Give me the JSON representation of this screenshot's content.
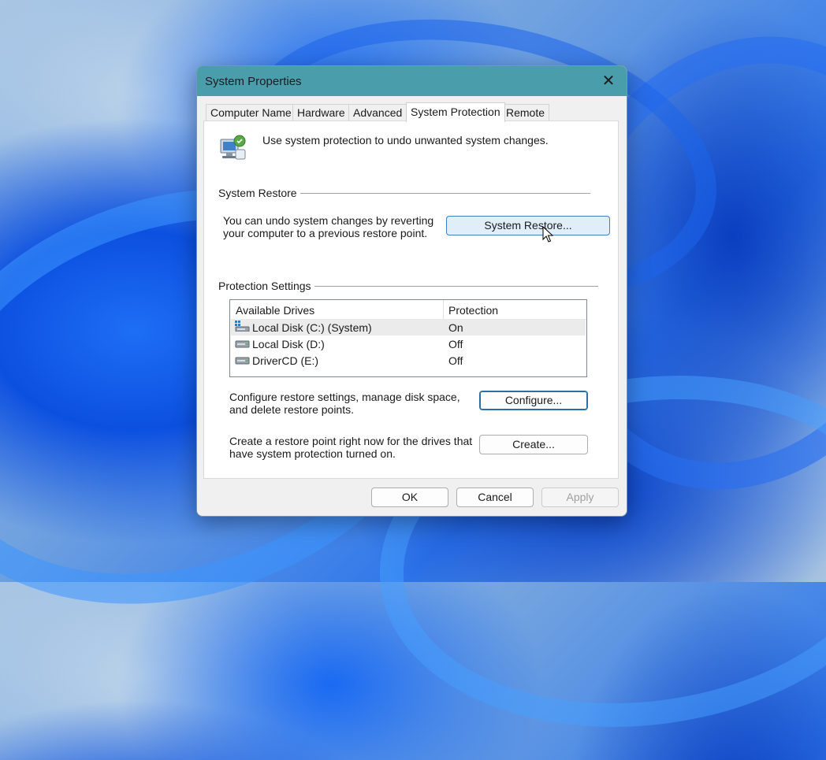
{
  "window": {
    "title": "System Properties"
  },
  "tabs": [
    {
      "label": "Computer Name"
    },
    {
      "label": "Hardware"
    },
    {
      "label": "Advanced"
    },
    {
      "label": "System Protection",
      "active": true
    },
    {
      "label": "Remote"
    }
  ],
  "intro_text": "Use system protection to undo unwanted system changes.",
  "system_restore": {
    "group_title": "System Restore",
    "description": "You can undo system changes by reverting your computer to a previous restore point.",
    "button_label": "System Restore..."
  },
  "protection_settings": {
    "group_title": "Protection Settings",
    "columns": [
      "Available Drives",
      "Protection"
    ],
    "drives": [
      {
        "name": "Local Disk (C:) (System)",
        "protection": "On",
        "icon": "system-drive-icon"
      },
      {
        "name": "Local Disk (D:)",
        "protection": "Off",
        "icon": "drive-icon"
      },
      {
        "name": "DriverCD (E:)",
        "protection": "Off",
        "icon": "drive-icon"
      }
    ],
    "configure_text": "Configure restore settings, manage disk space, and delete restore points.",
    "configure_label": "Configure...",
    "create_text": "Create a restore point right now for the drives that have system protection turned on.",
    "create_label": "Create..."
  },
  "footer": {
    "ok_label": "OK",
    "cancel_label": "Cancel",
    "apply_label": "Apply"
  },
  "colors": {
    "titlebar": "#4a9eac",
    "accent": "#2b6ea6"
  }
}
